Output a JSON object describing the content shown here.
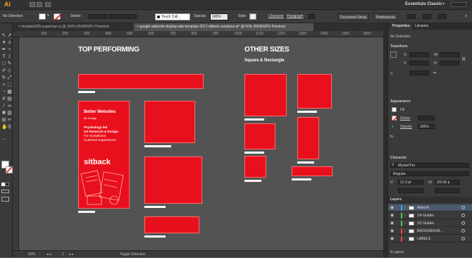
{
  "app": {
    "logo": "Ai",
    "workspace": "Essentials Classic"
  },
  "control_bar": {
    "selection": "No Selection",
    "stroke_label": "Stroke:",
    "brush": "Touch Call...",
    "opacity_label": "Opacity:",
    "opacity_value": "100%",
    "style_label": "Style:",
    "character": "Character",
    "paragraph": "Paragraph",
    "document_setup": "Document Setup",
    "preferences": "Preferences"
  },
  "tabs": [
    {
      "label": "template028-superman.ai @ 150% (RGB/GPU Preview)"
    },
    {
      "label": "google-adwords-display-ads-template-2017-sitback-solutions.ai* @ 50% (RGB/GPU Preview)"
    }
  ],
  "ruler": {
    "ticks": [
      "100",
      "200",
      "300",
      "400",
      "500",
      "600",
      "700",
      "800",
      "900",
      "1000",
      "1100",
      "1200",
      "1300",
      "1400",
      "1500",
      "1600"
    ]
  },
  "canvas": {
    "top_performing": "TOP PERFORMING",
    "other_sizes": "OTHER SIZES",
    "square_rect": "Square & Rectangle",
    "ad": {
      "headline": "Better Websites",
      "sub": "By Design",
      "body1": "Psychology-led",
      "body2": "UX Research & Design.",
      "body3": "For exceptional",
      "body4": "Customer Experiences.",
      "brand": "sitback"
    }
  },
  "status": {
    "zoom": "50%",
    "page": "2",
    "toggle": "Toggle Selection"
  },
  "panels": {
    "tab_properties": "Properties",
    "tab_libraries": "Libraries",
    "no_selection": "No Selection",
    "transform": "Transform",
    "x": "X:",
    "y": "Y:",
    "w": "W:",
    "h": "H:",
    "appearance": "Appearance",
    "fill": "Fill",
    "stroke": "Stroke",
    "opacity": "Opacity",
    "opacity_value": "100%",
    "fx": "fx.",
    "character": "Character",
    "font": "Myriad Pro",
    "font_style": "Regular",
    "size": "21.3 pt",
    "leading": "(25.56 p",
    "layers": "Layers",
    "layers_count": "5 Layers",
    "layer_items": [
      {
        "name": "Artwork",
        "color": "#4ea0e8"
      },
      {
        "name": "1/4 Guides",
        "color": "#49c45a"
      },
      {
        "name": "1/3 Guides",
        "color": "#49c45a"
      },
      {
        "name": "BACKGROUN...",
        "color": "#e84a4a"
      },
      {
        "name": "LABELS",
        "color": "#e84a4a"
      }
    ]
  },
  "colors": {
    "accent_red": "#e8101c",
    "bg": "#535353"
  }
}
